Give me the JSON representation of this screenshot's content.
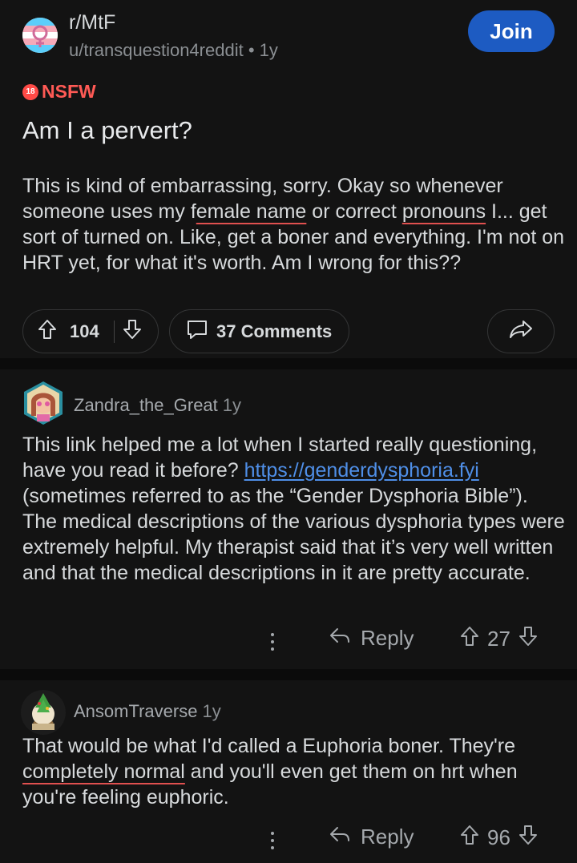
{
  "post": {
    "subreddit": "r/MtF",
    "author": "u/transquestion4reddit",
    "age": "1y",
    "join_label": "Join",
    "nsfw_badge": "18",
    "nsfw_label": "NSFW",
    "title": "Am I a pervert?",
    "body": {
      "p1": "This is kind of embarrassing, sorry. Okay so whenever someone uses my f",
      "p2": "emale name",
      "p3": " or correct ",
      "p4": "pronouns",
      "p5": " I... get sort of turned on. Like, get a boner and everything. I'm not on HRT yet, for what it's worth. Am I wrong for this??"
    },
    "upvotes": "104",
    "comments_label": "37 Comments"
  },
  "comments": [
    {
      "author": "Zandra_the_Great",
      "age": "1y",
      "text_before": "This link helped me a lot when I started really questioning, have you read it before? ",
      "link": "https://genderdysphoria.fyi",
      "text_after": " (sometimes referred to as the “Gender Dysphoria Bible”). The medical descriptions of the various dysphoria types were extremely helpful. My therapist said that it’s very well written and that the medical descriptions in it are pretty accurate.",
      "reply_label": "Reply",
      "score": "27"
    },
    {
      "author": "AnsomTraverse",
      "age": "1y",
      "text_before": "That would be what I'd called a Euphoria boner. They're ",
      "underlined": "completely normal",
      "text_after": " and you'll even get them on hrt when you're feeling euphoric.",
      "reply_label": "Reply",
      "score": "96"
    }
  ],
  "colors": {
    "join": "#1d5bc2",
    "nsfw": "#ff5a55",
    "link": "#4f8fe8",
    "spellcheck_underline": "#e0504f"
  },
  "icons": [
    "subreddit-trans-flag-icon",
    "upvote-icon",
    "downvote-icon",
    "comment-icon",
    "share-icon",
    "more-dots-icon",
    "reply-icon"
  ]
}
